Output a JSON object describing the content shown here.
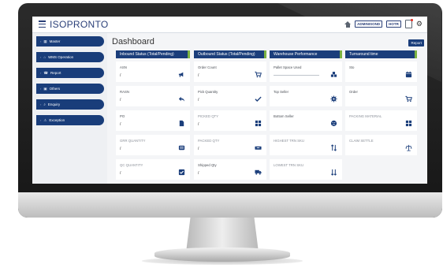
{
  "app": {
    "brand": "ISOPRONTO",
    "page_title": "Dashboard",
    "report_button": "Report"
  },
  "topbar": {
    "badge1": "ADMINISOND",
    "badge2": "HOTR"
  },
  "sidebar": {
    "items": [
      {
        "label": "Master",
        "icon": "grid-icon"
      },
      {
        "label": "WMS Operation",
        "icon": "home-icon"
      },
      {
        "label": "Report",
        "icon": "phone-icon"
      },
      {
        "label": "Others",
        "icon": "box-icon"
      },
      {
        "label": "Enquiry",
        "icon": "search-icon"
      },
      {
        "label": "Exception",
        "icon": "warning-icon"
      }
    ]
  },
  "columns": [
    {
      "header": "Inbound Status (Total/Pending)",
      "cards": [
        {
          "label": "ASN",
          "value": "/",
          "icon": "megaphone-icon"
        },
        {
          "label": "RASN",
          "value": "/",
          "icon": "reply-icon"
        },
        {
          "label": "PO",
          "value": "/",
          "icon": "file-icon"
        },
        {
          "label": "GRR QUANTITY",
          "value": "/",
          "icon": "list-icon"
        },
        {
          "label": "QC QUANTITY",
          "value": "/",
          "icon": "checkbox-icon"
        }
      ]
    },
    {
      "header": "Outbound Status (Total/Pending)",
      "cards": [
        {
          "label": "Order Count",
          "value": "/",
          "icon": "cart-icon"
        },
        {
          "label": "Pick Quantity",
          "value": "/",
          "icon": "check-icon"
        },
        {
          "label": "PICKED QTY",
          "value": "/",
          "icon": "grid-icon"
        },
        {
          "label": "PACKED QTY",
          "value": "/",
          "icon": "boxes-icon"
        },
        {
          "label": "Shipped Qty",
          "value": "/",
          "icon": "truck-icon"
        }
      ]
    },
    {
      "header": "Warehouse Performance",
      "cards": [
        {
          "label": "Pallet Space Used",
          "value": "",
          "icon": "cubes-icon",
          "progress": 0
        },
        {
          "label": "Top Seller",
          "value": "",
          "icon": "cog-icon"
        },
        {
          "label": "Bottom Seller",
          "value": "",
          "icon": "frown-icon"
        },
        {
          "label": "HIGHEST TRN SKU",
          "value": "",
          "icon": "sort-up-icon"
        },
        {
          "label": "LOWEST TRN SKU",
          "value": "",
          "icon": "sort-down-icon"
        }
      ]
    },
    {
      "header": "Turnaround time",
      "cards": [
        {
          "label": "Sto",
          "value": "",
          "icon": "calendar-icon"
        },
        {
          "label": "Order",
          "value": "",
          "icon": "cart-icon"
        },
        {
          "label": "PACKING MATERIAL",
          "value": "",
          "icon": "grid-icon"
        },
        {
          "label": "CLAIM SETTLE",
          "value": "",
          "icon": "scale-icon"
        }
      ]
    }
  ],
  "colors": {
    "primary": "#1b3e7b",
    "accent": "#7cb342",
    "alert": "#e2261a"
  }
}
